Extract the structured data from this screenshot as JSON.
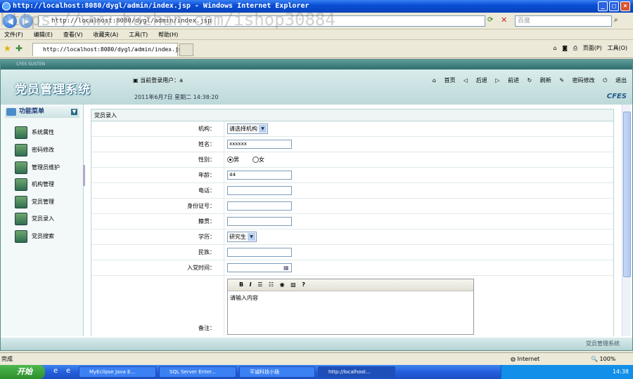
{
  "window": {
    "title": "http://localhost:8080/dygl/admin/index.jsp - Windows Internet Explorer"
  },
  "browser": {
    "address": "http://localhost:8080/dygl/admin/index.jsp",
    "watermark": "https://www.huzhan.com/ishop30884",
    "search_placeholder": "百度",
    "menu": [
      "文件(F)",
      "编辑(E)",
      "查看(V)",
      "收藏夹(A)",
      "工具(T)",
      "帮助(H)"
    ],
    "tab_title": "http://localhost:8080/dygl/admin/index.jsp",
    "tools": [
      "页面(P)",
      "工具(O)"
    ]
  },
  "app": {
    "strip_label": "CFES SUSTEN",
    "logo": "党员管理系统",
    "user_label": "当前登录用户：",
    "user_value": "a",
    "date": "2011年6月7日  星期二  14:38:20",
    "brand": "CFES",
    "top_nav": [
      "首页",
      "后退",
      "前进",
      "刷新",
      "密码修改",
      "退出"
    ],
    "sidebar_title": "功能菜单",
    "sidebar_items": [
      "系统属性",
      "密码修改",
      "管理员维护",
      "机构管理",
      "党员管理",
      "党员录入",
      "党员搜索"
    ],
    "footer": "党员管理系统"
  },
  "form": {
    "title": "党员录入",
    "org_label": "机构：",
    "org_value": "请选择机构",
    "name_label": "姓名：",
    "name_value": "xxxxxx",
    "gender_label": "性别：",
    "gender_male": "男",
    "gender_female": "女",
    "age_label": "年龄：",
    "age_value": "44",
    "phone_label": "电话：",
    "phone_value": "",
    "id_label": "身份证号：",
    "id_value": "",
    "native_label": "籍贯：",
    "native_value": "",
    "edu_label": "学历：",
    "edu_value": "研究生",
    "ethnic_label": "民族：",
    "ethnic_value": "",
    "join_label": "入党时间：",
    "join_value": "",
    "remark_label": "备注：",
    "editor_placeholder": "请输入内容",
    "editor_tools": [
      "B",
      "I"
    ]
  },
  "status": {
    "left": "完成",
    "zone": "Internet",
    "zoom": "100%"
  },
  "taskbar": {
    "start": "开始",
    "tasks": [
      "MyEclipse Java E...",
      "SQL Server Enter...",
      "平诚科技小插",
      "http://localhost..."
    ],
    "time": "14:38"
  }
}
